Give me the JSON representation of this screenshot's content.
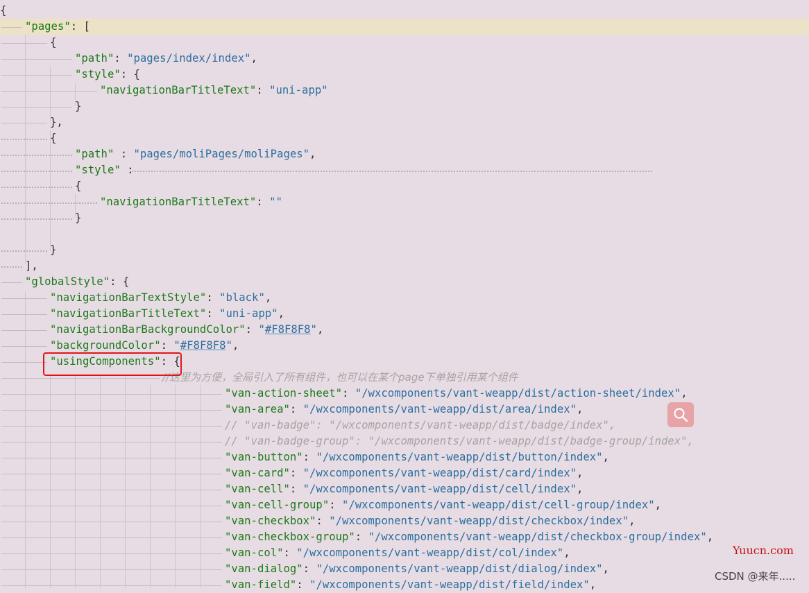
{
  "editor": {
    "lines": [
      {
        "indent": 0,
        "parts": [
          [
            "p",
            "{"
          ]
        ]
      },
      {
        "indent": 1,
        "hl": true,
        "parts": [
          [
            "k",
            "\"pages\""
          ],
          [
            "p",
            ": "
          ],
          [
            "p",
            "["
          ]
        ]
      },
      {
        "indent": 2,
        "parts": [
          [
            "p",
            "{"
          ]
        ]
      },
      {
        "indent": 3,
        "parts": [
          [
            "k",
            "\"path\""
          ],
          [
            "p",
            ": "
          ],
          [
            "s",
            "\"pages/index/index\""
          ],
          [
            "p",
            ","
          ]
        ]
      },
      {
        "indent": 3,
        "parts": [
          [
            "k",
            "\"style\""
          ],
          [
            "p",
            ": {"
          ]
        ]
      },
      {
        "indent": 4,
        "parts": [
          [
            "k",
            "\"navigationBarTitleText\""
          ],
          [
            "p",
            ": "
          ],
          [
            "s",
            "\"uni-app\""
          ]
        ]
      },
      {
        "indent": 3,
        "parts": [
          [
            "p",
            "}"
          ]
        ]
      },
      {
        "indent": 2,
        "parts": [
          [
            "p",
            "},"
          ]
        ]
      },
      {
        "indent": 2,
        "parts": [
          [
            "p",
            "{"
          ]
        ]
      },
      {
        "indent": 3,
        "parts": [
          [
            "k",
            "\"path\""
          ],
          [
            "p",
            " : "
          ],
          [
            "s",
            "\"pages/moliPages/moliPages\""
          ],
          [
            "p",
            ","
          ]
        ]
      },
      {
        "indent": 3,
        "parts": [
          [
            "k",
            "\"style\""
          ],
          [
            "p",
            " :"
          ]
        ]
      },
      {
        "indent": 3,
        "parts": [
          [
            "p",
            "{"
          ]
        ]
      },
      {
        "indent": 4,
        "parts": [
          [
            "k",
            "\"navigationBarTitleText\""
          ],
          [
            "p",
            ": "
          ],
          [
            "s",
            "\"\""
          ]
        ]
      },
      {
        "indent": 3,
        "parts": [
          [
            "p",
            "}"
          ]
        ]
      },
      {
        "indent": 0,
        "parts": []
      },
      {
        "indent": 2,
        "parts": [
          [
            "p",
            "}"
          ]
        ]
      },
      {
        "indent": 1,
        "parts": [
          [
            "p",
            "],"
          ]
        ]
      },
      {
        "indent": 1,
        "parts": [
          [
            "k",
            "\"globalStyle\""
          ],
          [
            "p",
            ": {"
          ]
        ]
      },
      {
        "indent": 2,
        "parts": [
          [
            "k",
            "\"navigationBarTextStyle\""
          ],
          [
            "p",
            ": "
          ],
          [
            "s",
            "\"black\""
          ],
          [
            "p",
            ","
          ]
        ]
      },
      {
        "indent": 2,
        "parts": [
          [
            "k",
            "\"navigationBarTitleText\""
          ],
          [
            "p",
            ": "
          ],
          [
            "s",
            "\"uni-app\""
          ],
          [
            "p",
            ","
          ]
        ]
      },
      {
        "indent": 2,
        "parts": [
          [
            "k",
            "\"navigationBarBackgroundColor\""
          ],
          [
            "p",
            ": "
          ],
          [
            "s",
            "\""
          ],
          [
            "su",
            "#F8F8F8"
          ],
          [
            "s",
            "\""
          ],
          [
            "p",
            ","
          ]
        ]
      },
      {
        "indent": 2,
        "parts": [
          [
            "k",
            "\"backgroundColor\""
          ],
          [
            "p",
            ": "
          ],
          [
            "s",
            "\""
          ],
          [
            "su",
            "#F8F8F8"
          ],
          [
            "s",
            "\""
          ],
          [
            "p",
            ","
          ]
        ]
      },
      {
        "indent": 2,
        "parts": [
          [
            "k",
            "\"usingComponents\""
          ],
          [
            "p",
            ": {"
          ]
        ]
      },
      {
        "indent": 6.5,
        "parts": [
          [
            "cc",
            "//这里为方便，全局引入了所有组件，也可以在某个page下单独引用某个组件"
          ]
        ]
      },
      {
        "indent": 9,
        "parts": [
          [
            "k",
            "\"van-action-sheet\""
          ],
          [
            "p",
            ": "
          ],
          [
            "s",
            "\"/wxcomponents/vant-weapp/dist/action-sheet/index\""
          ],
          [
            "p",
            ","
          ]
        ]
      },
      {
        "indent": 9,
        "parts": [
          [
            "k",
            "\"van-area\""
          ],
          [
            "p",
            ": "
          ],
          [
            "s",
            "\"/wxcomponents/vant-weapp/dist/area/index\""
          ],
          [
            "p",
            ","
          ]
        ]
      },
      {
        "indent": 9,
        "parts": [
          [
            "c",
            "// \"van-badge\": \"/wxcomponents/vant-weapp/dist/badge/index\","
          ]
        ]
      },
      {
        "indent": 9,
        "parts": [
          [
            "c",
            "// \"van-badge-group\": \"/wxcomponents/vant-weapp/dist/badge-group/index\","
          ]
        ]
      },
      {
        "indent": 9,
        "parts": [
          [
            "k",
            "\"van-button\""
          ],
          [
            "p",
            ": "
          ],
          [
            "s",
            "\"/wxcomponents/vant-weapp/dist/button/index\""
          ],
          [
            "p",
            ","
          ]
        ]
      },
      {
        "indent": 9,
        "parts": [
          [
            "k",
            "\"van-card\""
          ],
          [
            "p",
            ": "
          ],
          [
            "s",
            "\"/wxcomponents/vant-weapp/dist/card/index\""
          ],
          [
            "p",
            ","
          ]
        ]
      },
      {
        "indent": 9,
        "parts": [
          [
            "k",
            "\"van-cell\""
          ],
          [
            "p",
            ": "
          ],
          [
            "s",
            "\"/wxcomponents/vant-weapp/dist/cell/index\""
          ],
          [
            "p",
            ","
          ]
        ]
      },
      {
        "indent": 9,
        "parts": [
          [
            "k",
            "\"van-cell-group\""
          ],
          [
            "p",
            ": "
          ],
          [
            "s",
            "\"/wxcomponents/vant-weapp/dist/cell-group/index\""
          ],
          [
            "p",
            ","
          ]
        ]
      },
      {
        "indent": 9,
        "parts": [
          [
            "k",
            "\"van-checkbox\""
          ],
          [
            "p",
            ": "
          ],
          [
            "s",
            "\"/wxcomponents/vant-weapp/dist/checkbox/index\""
          ],
          [
            "p",
            ","
          ]
        ]
      },
      {
        "indent": 9,
        "parts": [
          [
            "k",
            "\"van-checkbox-group\""
          ],
          [
            "p",
            ": "
          ],
          [
            "s",
            "\"/wxcomponents/vant-weapp/dist/checkbox-group/index\""
          ],
          [
            "p",
            ","
          ]
        ]
      },
      {
        "indent": 9,
        "parts": [
          [
            "k",
            "\"van-col\""
          ],
          [
            "p",
            ": "
          ],
          [
            "s",
            "\"/wxcomponents/vant-weapp/dist/col/index\""
          ],
          [
            "p",
            ","
          ]
        ]
      },
      {
        "indent": 9,
        "parts": [
          [
            "k",
            "\"van-dialog\""
          ],
          [
            "p",
            ": "
          ],
          [
            "s",
            "\"/wxcomponents/vant-weapp/dist/dialog/index\""
          ],
          [
            "p",
            ","
          ]
        ]
      },
      {
        "indent": 9,
        "parts": [
          [
            "k",
            "\"van-field\""
          ],
          [
            "p",
            ": "
          ],
          [
            "s",
            "\"/wxcomponents/vant-weapp/dist/field/index\""
          ],
          [
            "p",
            ","
          ]
        ]
      }
    ]
  },
  "overlay": {
    "search_icon": "magnifier-icon",
    "watermark_site": "Yuucn.com",
    "watermark_author": "CSDN @来年....."
  },
  "colors": {
    "background": "#e8dce4",
    "key": "#1a7a1a",
    "string": "#2a6f9e",
    "comment": "#a4a4a4",
    "highlight": "#e0151a"
  }
}
